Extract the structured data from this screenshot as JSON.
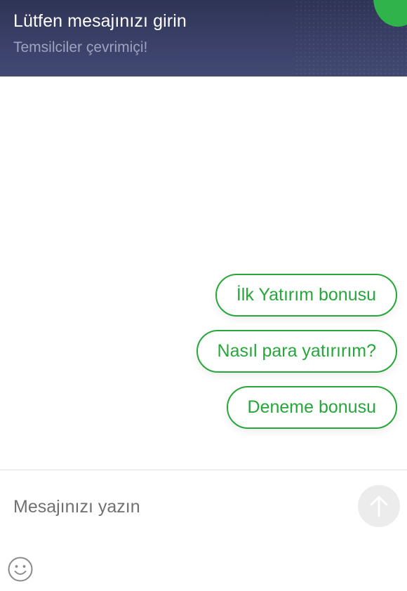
{
  "header": {
    "title": "Lütfen mesajınızı girin",
    "subtitle": "Temsilciler çevrimiçi!"
  },
  "quick_replies": [
    {
      "label": "İlk Yatırım bonusu"
    },
    {
      "label": "Nasıl para yatırırım?"
    },
    {
      "label": "Deneme bonusu"
    }
  ],
  "composer": {
    "placeholder": "Mesajınızı yazın",
    "send_icon": "arrow-up-icon",
    "emoji_icon": "smiley-icon"
  },
  "colors": {
    "header_bg": "#3b416a",
    "accent_green": "#25a73a",
    "status_green": "#2fb34a",
    "send_button_bg": "#ececec"
  }
}
